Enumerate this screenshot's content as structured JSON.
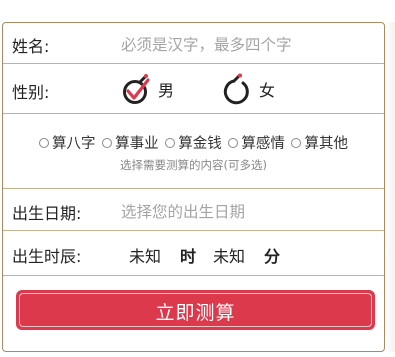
{
  "form": {
    "name_label": "姓名:",
    "name_placeholder": "必须是汉字，最多四个字",
    "gender_label": "性别:",
    "gender_male": "男",
    "gender_female": "女",
    "options": [
      "算八字",
      "算事业",
      "算金钱",
      "算感情",
      "算其他"
    ],
    "options_hint": "选择需要测算的内容(可多选)",
    "birth_date_label": "出生日期:",
    "birth_date_placeholder": "选择您的出生日期",
    "birth_time_label": "出生时辰:",
    "hour_value": "未知",
    "hour_unit": "时",
    "minute_value": "未知",
    "minute_unit": "分",
    "submit_label": "立即测算"
  },
  "colors": {
    "accent": "#dc3a4c",
    "border": "#a88a60"
  },
  "icons": {
    "gender_male": "male-selected-icon",
    "gender_female": "female-unselected-icon"
  }
}
